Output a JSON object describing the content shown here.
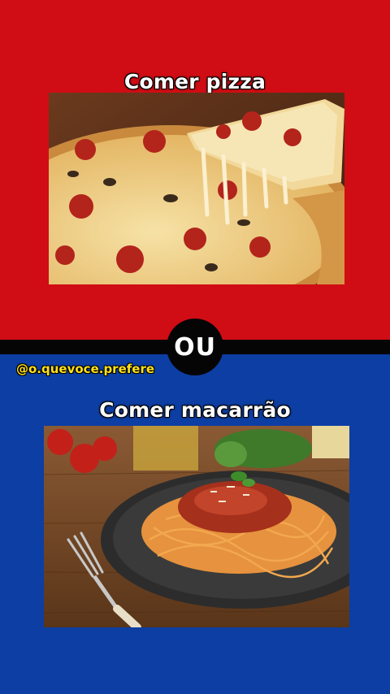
{
  "option_a": {
    "label": "Comer pizza",
    "image": "pizza-photo"
  },
  "separator": {
    "label": "OU"
  },
  "account": {
    "handle": "@o.quevoce.prefere"
  },
  "option_b": {
    "label": "Comer macarrão",
    "image": "spaghetti-photo"
  },
  "colors": {
    "top_bg": "#d00d14",
    "bottom_bg": "#0d3ea3",
    "handle": "#ffe21a"
  }
}
